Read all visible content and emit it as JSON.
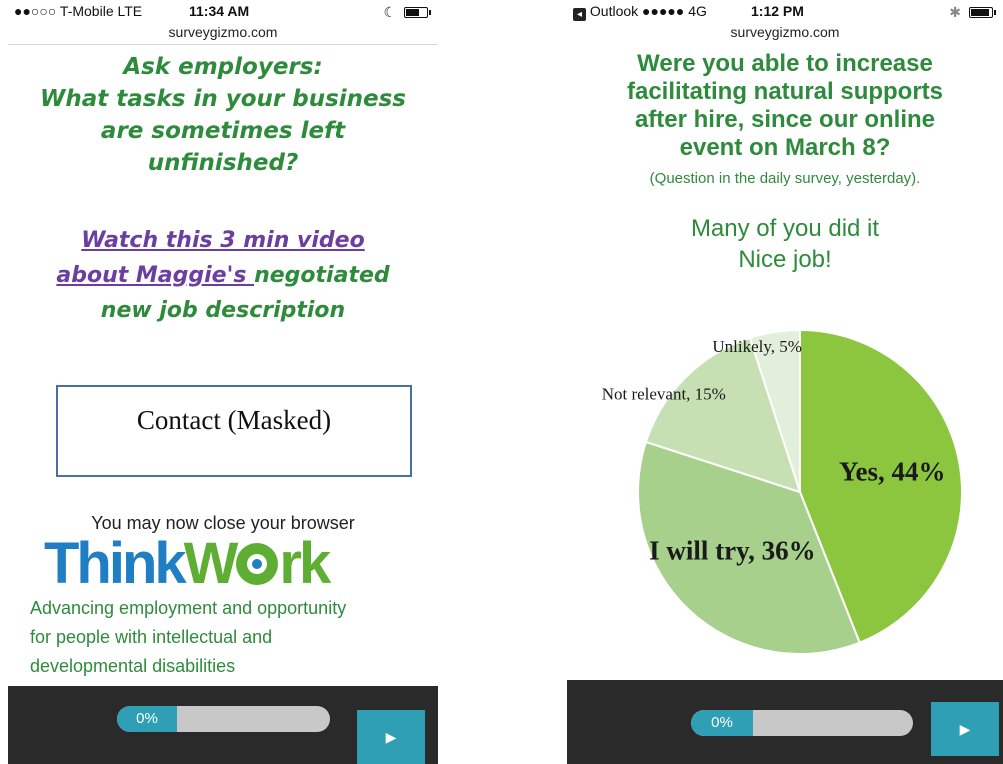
{
  "left_phone": {
    "status": {
      "carrier": "●●○○○ T-Mobile  LTE",
      "time": "11:34 AM"
    },
    "url": "surveygizmo.com",
    "heading_lines": [
      "Ask employers:",
      "What tasks in your business",
      "are sometimes left",
      "unfinished?"
    ],
    "video": {
      "link_line1": "Watch this 3 min video",
      "link_line2": "about Maggie's ",
      "rest_line2": "negotiated",
      "line3": "new job description"
    },
    "contact_label": "Contact (Masked)",
    "close_message": "You may now close your browser",
    "logo": {
      "think": "Think",
      "work_w": "W",
      "work_rest": "rk"
    },
    "tagline_lines": [
      "Advancing employment and opportunity",
      "for people with intellectual and",
      "developmental disabilities"
    ],
    "progress": {
      "label": "0%",
      "fraction": 0.0
    },
    "next_icon": "play-arrow-icon"
  },
  "right_phone": {
    "status": {
      "back_app": "Outlook",
      "signal": "●●●●●  4G",
      "time": "1:12 PM"
    },
    "url": "surveygizmo.com",
    "question_lines": [
      "Were you able to increase",
      "facilitating natural supports",
      "after hire, since our online",
      "event on March 8?"
    ],
    "question_note": "(Question in the daily survey, yesterday).",
    "praise_lines": [
      "Many of you did it",
      "Nice job!"
    ],
    "progress": {
      "label": "0%",
      "fraction": 0.0
    },
    "next_icon": "play-arrow-icon"
  },
  "chart_data": {
    "type": "pie",
    "title": "",
    "slices": [
      {
        "label": "Yes, 44%",
        "value": 44,
        "color": "#8cc63f"
      },
      {
        "label": "I will try, 36%",
        "value": 36,
        "color": "#a8d08d"
      },
      {
        "label": "Not relevant, 15%",
        "value": 15,
        "color": "#c6e0b4"
      },
      {
        "label": "Unlikely, 5%",
        "value": 5,
        "color": "#e2efda"
      }
    ]
  }
}
